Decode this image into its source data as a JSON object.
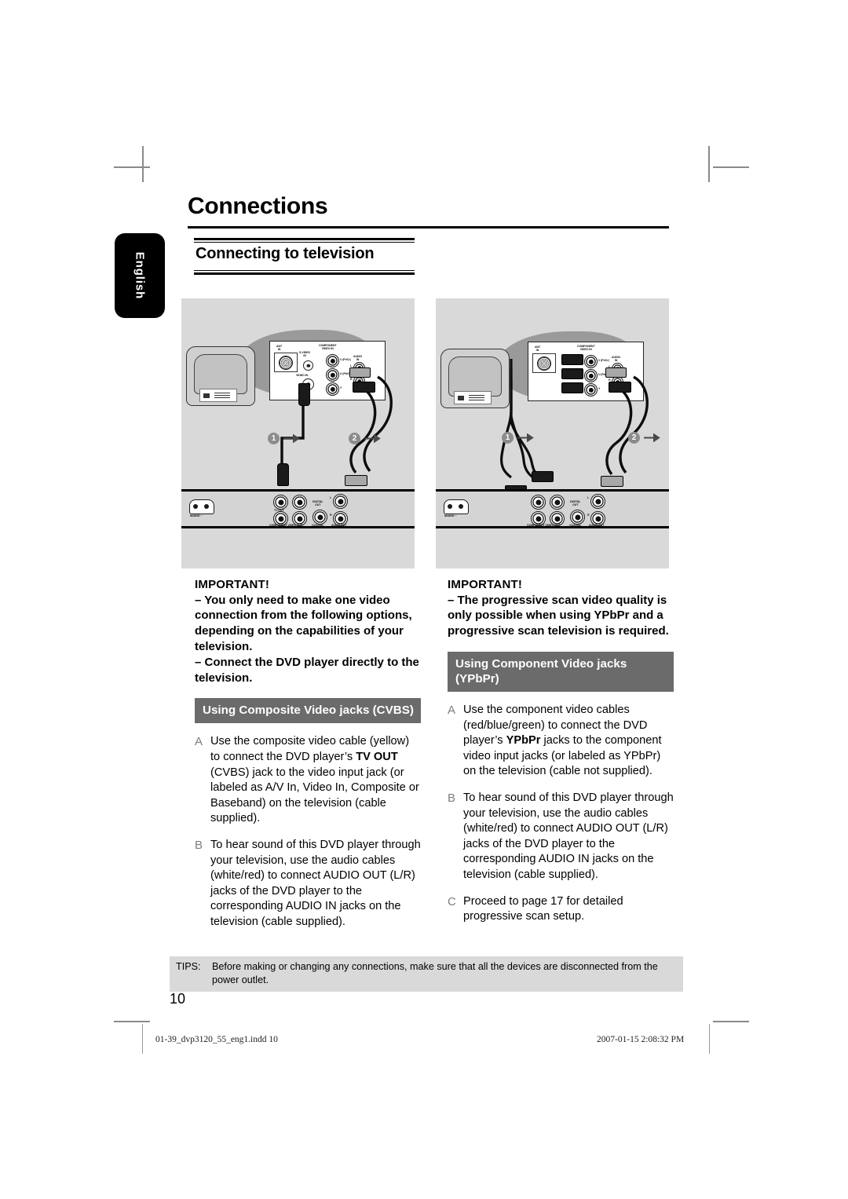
{
  "document": {
    "chapter_title": "Connections",
    "language_tab": "English",
    "section_heading": "Connecting to television",
    "page_number": "10"
  },
  "columns": {
    "left": {
      "important_title": "IMPORTANT!",
      "important_lines": [
        "– You only need to make one video connection from the following options, depending on the capabilities of your television.",
        "– Connect the DVD player directly to the television."
      ],
      "gray_heading": "Using Composite Video jacks (CVBS)",
      "steps": [
        {
          "letter": "A",
          "text_before": "Use the composite video cable (yellow) to connect the DVD player’s ",
          "bold": "TV OUT",
          "text_after": " (CVBS) jack to the video input jack (or labeled as A/V In, Video In, Composite or Baseband) on the television (cable supplied)."
        },
        {
          "letter": "B",
          "text_before": "To hear sound of this DVD player through your television, use the audio cables (white/red) to connect AUDIO OUT (L/R) jacks of the DVD player to the corresponding AUDIO IN jacks on the television (cable supplied).",
          "bold": "",
          "text_after": ""
        }
      ]
    },
    "right": {
      "important_title": "IMPORTANT!",
      "important_lines": [
        "– The progressive scan video quality is only possible when using YPbPr and a progressive scan television is required."
      ],
      "gray_heading": "Using Component Video jacks (YPbPr)",
      "steps": [
        {
          "letter": "A",
          "text_before": "Use the component video cables (red/blue/green) to connect the DVD player’s ",
          "bold": "YPbPr",
          "text_after": " jacks to the component video input jacks (or labeled as YPbPr) on the television (cable not supplied)."
        },
        {
          "letter": "B",
          "text_before": "To hear sound of this DVD player through your television, use the audio cables (white/red) to connect AUDIO OUT (L/R) jacks of the DVD player to the corresponding AUDIO IN jacks on the television (cable supplied).",
          "bold": "",
          "text_after": ""
        },
        {
          "letter": "C",
          "text_before": "Proceed to page 17 for detailed progressive scan setup.",
          "bold": "",
          "text_after": ""
        }
      ]
    }
  },
  "tips": {
    "label": "TIPS:",
    "text": "Before making or changing any connections, make sure that all the devices are disconnected from the power outlet."
  },
  "footer": {
    "file_name": "01-39_dvp3120_55_eng1.indd   10",
    "timestamp": "2007-01-15   2:08:32 PM"
  },
  "diagram_left": {
    "step_1": "1",
    "step_2": "2",
    "tv_panel": {
      "ant_in": "ANT\nIN",
      "s_video_in": "S-VIDEO\nIN",
      "component_video_in": "COMPONENT\nVIDEO IN",
      "jack_v": "V (Pr/Cr)",
      "jack_u": "U (Pb/Cb)",
      "jack_y": "Y",
      "video_in": "VIDEO IN",
      "audio_in": "AUDIO\nIN",
      "audio_l": "L",
      "audio_r": "R"
    },
    "dvd_panel": {
      "mains": "MAINS ~",
      "tv_out": "TV OUT",
      "component_video_out": "COMPONENT VIDEO OUT",
      "out_pr": "Pr",
      "out_pb": "Pb",
      "out_y": "Y",
      "digital_out": "DIGITAL\nOUT",
      "coaxial": "COAXIAL",
      "audio_out": "AUDIO OUT",
      "audio_l": "L",
      "audio_r": "R"
    }
  },
  "diagram_right": {
    "step_1": "1",
    "step_2": "2",
    "tv_panel": {
      "ant_in": "ANT\nIN",
      "component_video_in": "COMPONENT\nVIDEO IN",
      "jack_v": "V (Pr/Cr)",
      "jack_u": "U (Pb/Cb)",
      "jack_y": "Y",
      "audio_in": "AUDIO\nIN",
      "audio_l": "L",
      "audio_r": "R"
    },
    "dvd_panel": {
      "mains": "MAINS ~",
      "component_video_out": "COMPONENT VIDEO OUT",
      "out_pr": "Pr",
      "out_pb": "Pb",
      "out_y": "Y",
      "digital_out": "DIGITAL\nOUT",
      "coaxial": "COAXIAL",
      "audio_out": "AUDIO OUT",
      "audio_l": "L",
      "audio_r": "R"
    }
  },
  "colors": {
    "gray_heading_bg": "#6b6b6b",
    "diagram_bg": "#d9d9d9",
    "tips_bg": "#d9d9d9",
    "step_badge": "#8c8c8c"
  }
}
